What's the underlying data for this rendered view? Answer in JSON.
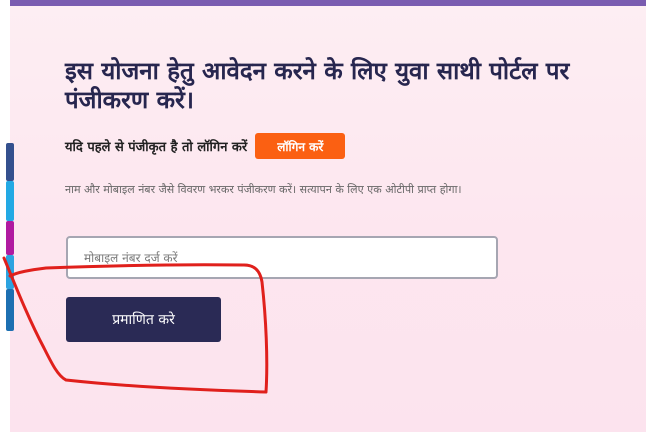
{
  "page": {
    "heading": "इस योजना हेतु आवेदन करने के लिए युवा साथी पोर्टल पर पंजीकरण करें।"
  },
  "login": {
    "prompt": "यदि पहले से पंजीकृत है तो लॉगिन करें",
    "button_label": "लॉगिन करें",
    "button_color": "#fb6012"
  },
  "description": "नाम और मोबाइल नंबर जैसे विवरण भरकर पंजीकरण करें। सत्यापन के लिए एक ओटीपी प्राप्त होगा।",
  "form": {
    "mobile_placeholder": "मोबाइल नंबर दर्ज करें",
    "mobile_value": "",
    "verify_label": "प्रमाणित करे",
    "verify_color": "#2a2a55"
  },
  "social_share": {
    "icons": [
      "facebook-icon",
      "twitter-icon",
      "instagram-icon",
      "telegram-icon",
      "linkedin-icon"
    ]
  },
  "colors": {
    "top_bar": "#7a5cb0",
    "heading_text": "#27264f",
    "annotation_stroke": "#e0201c"
  }
}
